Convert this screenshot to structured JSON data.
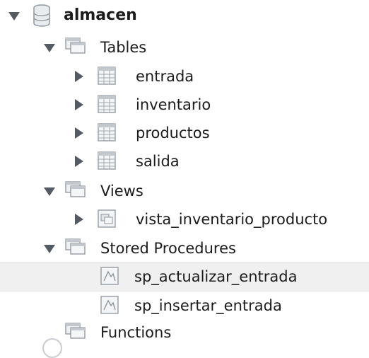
{
  "tree": {
    "schema": {
      "name": "almacen",
      "icon": "database-icon",
      "expanded": true
    },
    "tables_folder": {
      "label": "Tables",
      "icon": "folder-icon",
      "expanded": true
    },
    "tables": [
      {
        "label": "entrada",
        "icon": "table-icon"
      },
      {
        "label": "inventario",
        "icon": "table-icon"
      },
      {
        "label": "productos",
        "icon": "table-icon"
      },
      {
        "label": "salida",
        "icon": "table-icon"
      }
    ],
    "views_folder": {
      "label": "Views",
      "icon": "folder-icon",
      "expanded": true
    },
    "views": [
      {
        "label": "vista_inventario_producto",
        "icon": "view-icon"
      }
    ],
    "procedures_folder": {
      "label": "Stored Procedures",
      "icon": "folder-icon",
      "expanded": true
    },
    "procedures": [
      {
        "label": "sp_actualizar_entrada",
        "icon": "procedure-icon",
        "selected": true
      },
      {
        "label": "sp_insertar_entrada",
        "icon": "procedure-icon"
      }
    ],
    "functions_folder": {
      "label": "Functions",
      "icon": "folder-icon"
    }
  },
  "colors": {
    "arrow": "#555b62",
    "selected_bg": "#f0f0f0",
    "text": "#1b1b1b"
  }
}
